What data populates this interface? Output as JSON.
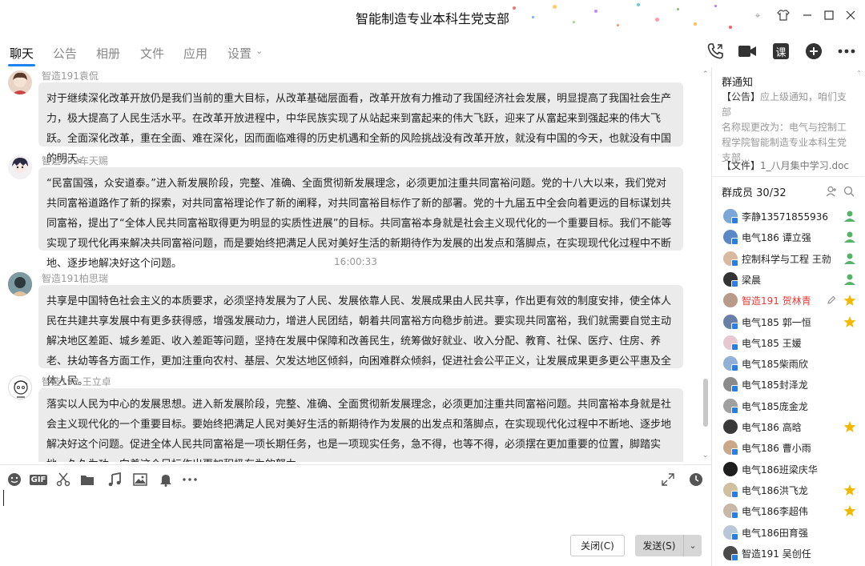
{
  "window": {
    "title": "智能制造专业本科生党支部"
  },
  "tabs": [
    {
      "label": "聊天",
      "active": true
    },
    {
      "label": "公告"
    },
    {
      "label": "相册"
    },
    {
      "label": "文件"
    },
    {
      "label": "应用"
    },
    {
      "label": "设置"
    }
  ],
  "top_actions": {
    "course_label": "课",
    "icons": [
      "phone-icon",
      "video-icon",
      "course-icon",
      "add-icon",
      "more-icon"
    ]
  },
  "messages": [
    {
      "sender": "智造191袁侃",
      "text": "对于继续深化改革开放仍是我们当前的重大目标，从改革基础层面看，改革开放有力推动了我国经济社会发展，明显提高了我国社会生产力，极大提高了人民生活水平。在改革开放进程中，中华民族实现了从站起来到富起来的伟大飞跃，迎来了从富起来到强起来的伟大飞跃。全面深化改革，重在全面、难在深化，因而面临难得的历史机遇和全新的风险挑战没有改革开放，就没有中国的今天，也就没有中国的明天。"
    },
    {
      "sender": "智造192车天赐",
      "text": "“民富国强，众安道泰。”进入新发展阶段，完整、准确、全面贯彻新发展理念，必须更加注重共同富裕问题。党的十八大以来，我们党对共同富裕道路作了新的探索，对共同富裕理论作了新的阐释，对共同富裕目标作了新的部署。党的十九届五中全会向着更远的目标谋划共同富裕，提出了“全体人民共同富裕取得更为明显的实质性进展”的目标。共同富裕本身就是社会主义现代化的一个重要目标。我们不能等实现了现代化再来解决共同富裕问题，而是要始终把满足人民对美好生活的新期待作为发展的出发点和落脚点，在实现现代化过程中不断地、逐步地解决好这个问题。"
    },
    {
      "timestamp": "16:00:33"
    },
    {
      "sender": "智造191柏思瑞",
      "text": "共享是中国特色社会主义的本质要求，必须坚持发展为了人民、发展依靠人民、发展成果由人民共享，作出更有效的制度安排，使全体人民在共建共享发展中有更多获得感，增强发展动力，增进人民团结，朝着共同富裕方向稳步前进。要实现共同富裕，我们就需要自觉主动解决地区差距、城乡差距、收入差距等问题，坚持在发展中保障和改善民生，统筹做好就业、收入分配、教育、社保、医疗、住房、养老、扶幼等各方面工作，更加注重向农村、基层、欠发达地区倾斜，向困难群众倾斜，促进社会公平正义，让发展成果更多更公平惠及全体人民。"
    },
    {
      "sender": "智造192 王立卓",
      "text": "落实以人民为中心的发展思想。进入新发展阶段，完整、准确、全面贯彻新发展理念，必须更加注重共同富裕问题。共同富裕本身就是社会主义现代化的一个重要目标。要始终把满足人民对美好生活的新期待作为发展的出发点和落脚点，在实现现代化过程中不断地、逐步地解决好这个问题。促进全体人民共同富裕是一项长期任务，也是一项现实任务，急不得，也等不得，必须摆在更加重要的位置，脚踏实地，久久为功，向着这个目标作出更加积极有为的努力。"
    }
  ],
  "composer": {
    "close_label": "关闭(C)",
    "send_label": "发送(S)"
  },
  "group_notice": {
    "title": "群通知",
    "notice_tag": "【公告】",
    "notice_line1": "应上级通知，咱们支部",
    "notice_rest": "名称现更改为：电气与控制工程学院智能制造专业本科生党支部...",
    "file_tag": "【文件】",
    "file_name": "1_八月集中学习.doc"
  },
  "members_header": {
    "label": "群成员 30/32"
  },
  "members": [
    {
      "name": "李静13571855936",
      "avatar_color": "#7aa6d8",
      "role": "admin",
      "badge": true
    },
    {
      "name": "电气186 谭立强",
      "avatar_color": "#5b89c7",
      "role": "admin",
      "badge": true
    },
    {
      "name": "控制科学与工程 王勍",
      "avatar_color": "#d9b9a0",
      "role": "admin",
      "badge": true
    },
    {
      "name": "梁晨",
      "avatar_color": "#333333",
      "role": "admin",
      "badge": true
    },
    {
      "name": "智造191 贺林青",
      "avatar_color": "#b89a8a",
      "role": "star",
      "badge": false,
      "highlight": true,
      "editable": true
    },
    {
      "name": "电气185 郭一恒",
      "avatar_color": "#6a7fa8",
      "role": "star",
      "badge": true
    },
    {
      "name": "电气185 王媛",
      "avatar_color": "#e8c8d0",
      "role": "",
      "badge": true
    },
    {
      "name": "电气185柴雨欣",
      "avatar_color": "#90b0d8",
      "role": "",
      "badge": true
    },
    {
      "name": "电气185封泽龙",
      "avatar_color": "#8a8a8a",
      "role": "",
      "badge": true
    },
    {
      "name": "电气185庞金龙",
      "avatar_color": "#a0a0a0",
      "role": "",
      "badge": true
    },
    {
      "name": "电气186 高晗",
      "avatar_color": "#3a3a3a",
      "role": "star",
      "badge": false
    },
    {
      "name": "电气186 曹小雨",
      "avatar_color": "#c9a98a",
      "role": "",
      "badge": true
    },
    {
      "name": "电气186班梁庆华",
      "avatar_color": "#1e1e1e",
      "role": "",
      "badge": false
    },
    {
      "name": "电气186洪飞龙",
      "avatar_color": "#d0c0a0",
      "role": "star",
      "badge": true
    },
    {
      "name": "电气186李超伟",
      "avatar_color": "#c8b8a8",
      "role": "star",
      "badge": true
    },
    {
      "name": "电气186田育强",
      "avatar_color": "#b8c8d8",
      "role": "",
      "badge": true
    },
    {
      "name": "智造191 吴创任",
      "avatar_color": "#4a4a4a",
      "role": "",
      "badge": true
    }
  ],
  "colors": {
    "accent": "#1c83f0",
    "bubble": "#ebebeb",
    "highlight_name": "#e53935",
    "admin_icon": "#57b36a",
    "star_icon": "#f5b800"
  }
}
